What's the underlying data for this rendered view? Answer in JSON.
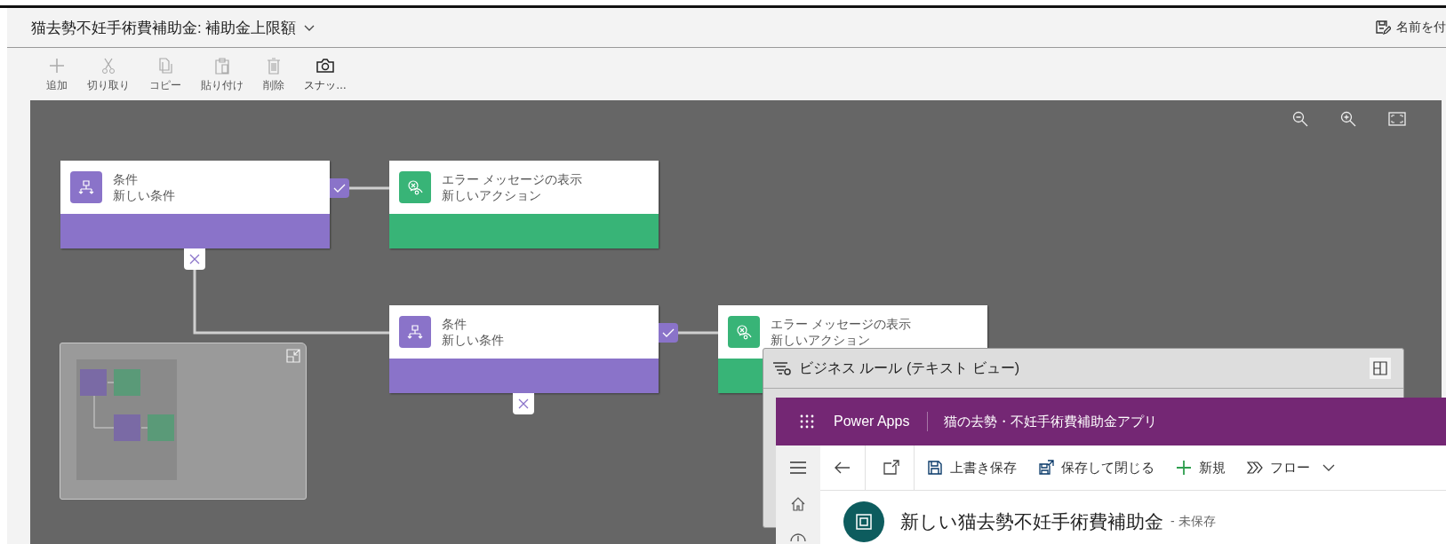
{
  "header": {
    "title": "猫去勢不妊手術費補助金: 補助金上限額",
    "save_as": "名前を付"
  },
  "toolbar": [
    {
      "kind": "add",
      "label": "追加",
      "disabled": true
    },
    {
      "kind": "cut",
      "label": "切り取り",
      "disabled": true
    },
    {
      "kind": "copy",
      "label": "コピー",
      "disabled": true
    },
    {
      "kind": "paste",
      "label": "貼り付け",
      "disabled": true
    },
    {
      "kind": "delete",
      "label": "削除",
      "disabled": true
    },
    {
      "kind": "snapshot",
      "label": "スナッ…",
      "disabled": false
    }
  ],
  "canvas": {
    "nodes": [
      {
        "kind": "condition",
        "type_label": "条件",
        "name": "新しい条件"
      },
      {
        "kind": "action",
        "type_label": "エラー メッセージの表示",
        "name": "新しいアクション"
      },
      {
        "kind": "condition",
        "type_label": "条件",
        "name": "新しい条件"
      },
      {
        "kind": "action",
        "type_label": "エラー メッセージの表示",
        "name": "新しいアクション"
      }
    ]
  },
  "text_view": {
    "title": "ビジネス ルール (テキスト ビュー)"
  },
  "power_apps": {
    "brand": "Power Apps",
    "app_name": "猫の去勢・不妊手術費補助金アプリ",
    "commands": [
      {
        "kind": "save",
        "label": "上書き保存"
      },
      {
        "kind": "save_close",
        "label": "保存して閉じる"
      },
      {
        "kind": "new",
        "label": "新規"
      },
      {
        "kind": "flow",
        "label": "フロー"
      }
    ],
    "form_title": "新しい猫去勢不妊手術費補助金",
    "form_status": "- 未保存"
  }
}
